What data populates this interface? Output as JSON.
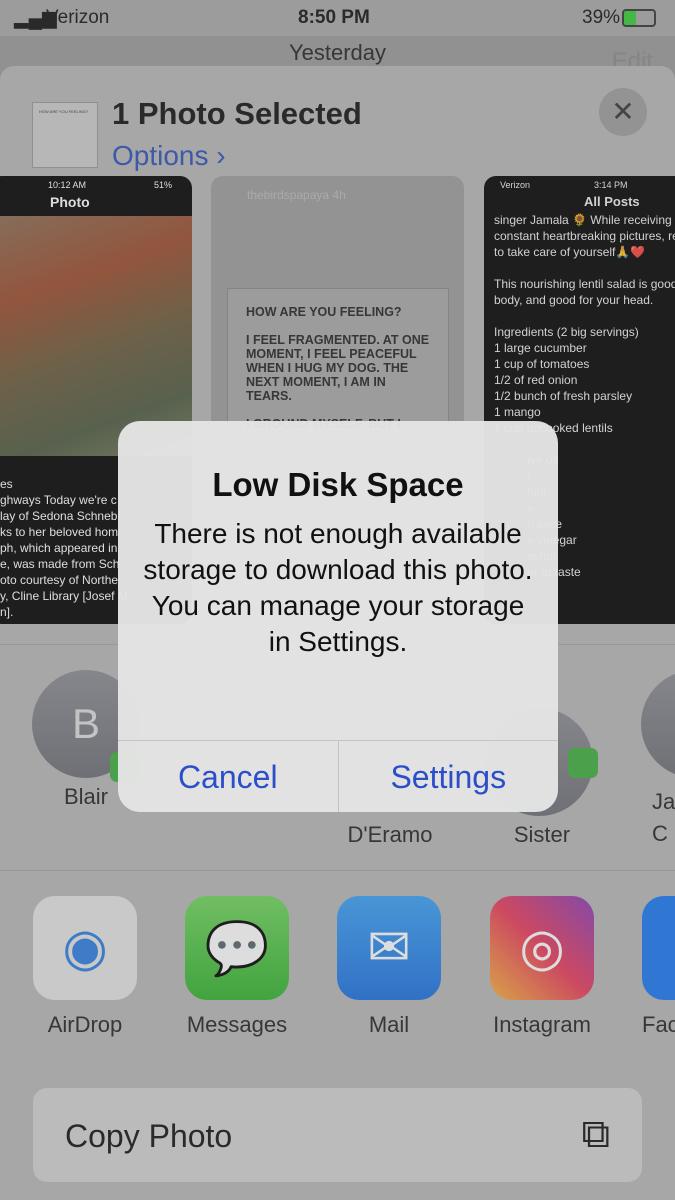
{
  "status": {
    "carrier": "Verizon",
    "time": "8:50 PM",
    "battery": "39%"
  },
  "background": {
    "title": "Yesterday",
    "edit": "Edit"
  },
  "sheet": {
    "title": "1 Photo Selected",
    "options": "Options ›",
    "close": "✕",
    "thumb_text": "HOW ARE YOU FEELING?"
  },
  "previews": [
    {
      "time": "10:12 AM",
      "battery": "51%",
      "title": "Photo",
      "caption": "es\nghways Today we're c\nlay of Sedona Schnebl\nks to her beloved hom\nph, which appeared in\ne, was made from Sch\noto courtesy of Northe\ny, Cline Library [Josef M\nn]."
    },
    {
      "user": "thebirdspapaya",
      "age": "4h",
      "text": "HOW ARE YOU FEELING?\n\nI FEEL FRAGMENTED. AT ONE\nMOMENT, I FEEL PEACEFUL\nWHEN I HUG MY DOG. THE\nNEXT MOMENT, I AM IN\nTEARS.\n\nI GROUND MYSELF, BUT I"
    },
    {
      "carrier": "Verizon",
      "time": "3:14 PM",
      "title": "All Posts",
      "text": "singer Jamala 🌻 While receiving\nconstant heartbreaking pictures, re\nto take care of yourself🙏❤️\n\nThis nourishing lentil salad is good\nbody, and good for your head.\n\nIngredients (2 big servings)\n1 large cucumber\n1 cup of tomatoes\n1/2 of red onion\n1/2 bunch of fresh parsley\n1 mango\n1 cup uncooked lentils\n\n          ive oil\n          r\n          hini\n          e\n          n juice\n          e vinegar\n          syrup\n          er to taste"
    }
  ],
  "people": [
    {
      "initial": "B",
      "name": "Blair"
    },
    {
      "initial": "",
      "name": "D'Eramo"
    },
    {
      "initial": "",
      "name": "Sister"
    },
    {
      "initial": "J",
      "name": "Ja C"
    }
  ],
  "apps": [
    {
      "name": "AirDrop",
      "icon": "airdrop-icon"
    },
    {
      "name": "Messages",
      "icon": "messages-icon"
    },
    {
      "name": "Mail",
      "icon": "mail-icon"
    },
    {
      "name": "Instagram",
      "icon": "instagram-icon"
    },
    {
      "name": "Fac",
      "icon": "facebook-icon"
    }
  ],
  "action": {
    "label": "Copy Photo",
    "icon": "copy-icon"
  },
  "alert": {
    "title": "Low Disk Space",
    "message": "There is not enough available storage to download this photo. You can manage your storage in Settings.",
    "cancel": "Cancel",
    "settings": "Settings"
  },
  "colors": {
    "link": "#2a4fc8",
    "messages": "#3cae3e"
  }
}
